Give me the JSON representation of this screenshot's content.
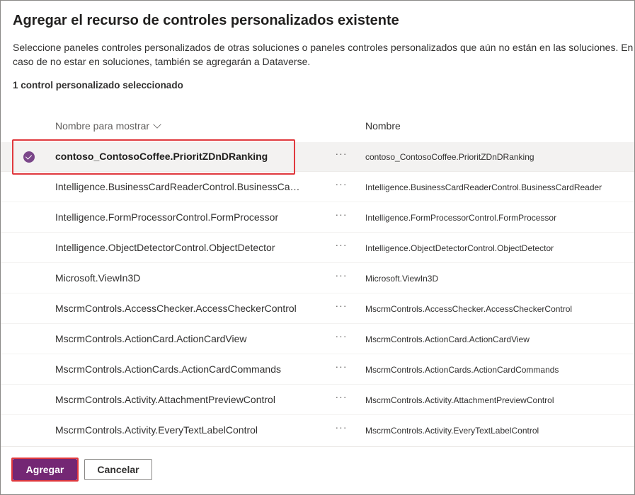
{
  "dialog": {
    "title": "Agregar el recurso de controles personalizados existente",
    "description": "Seleccione paneles controles personalizados de otras soluciones o paneles controles personalizados que aún no están en las soluciones. En caso de no estar en soluciones, también se agregarán a Dataverse.",
    "selected_count": "1 control personalizado seleccionado"
  },
  "table": {
    "columns": {
      "display_name": "Nombre para mostrar",
      "name": "Nombre"
    },
    "more_glyph": "···",
    "rows": [
      {
        "display": "contoso_ContosoCoffee.PrioritZDnDRanking",
        "name": "contoso_ContosoCoffee.PrioritZDnDRanking",
        "selected": true
      },
      {
        "display": "Intelligence.BusinessCardReaderControl.BusinessCardReader",
        "name": "Intelligence.BusinessCardReaderControl.BusinessCardReader",
        "selected": false
      },
      {
        "display": "Intelligence.FormProcessorControl.FormProcessor",
        "name": "Intelligence.FormProcessorControl.FormProcessor",
        "selected": false
      },
      {
        "display": "Intelligence.ObjectDetectorControl.ObjectDetector",
        "name": "Intelligence.ObjectDetectorControl.ObjectDetector",
        "selected": false
      },
      {
        "display": "Microsoft.ViewIn3D",
        "name": "Microsoft.ViewIn3D",
        "selected": false
      },
      {
        "display": "MscrmControls.AccessChecker.AccessCheckerControl",
        "name": "MscrmControls.AccessChecker.AccessCheckerControl",
        "selected": false
      },
      {
        "display": "MscrmControls.ActionCard.ActionCardView",
        "name": "MscrmControls.ActionCard.ActionCardView",
        "selected": false
      },
      {
        "display": "MscrmControls.ActionCards.ActionCardCommands",
        "name": "MscrmControls.ActionCards.ActionCardCommands",
        "selected": false
      },
      {
        "display": "MscrmControls.Activity.AttachmentPreviewControl",
        "name": "MscrmControls.Activity.AttachmentPreviewControl",
        "selected": false
      },
      {
        "display": "MscrmControls.Activity.EveryTextLabelControl",
        "name": "MscrmControls.Activity.EveryTextLabelControl",
        "selected": false
      }
    ]
  },
  "footer": {
    "add_label": "Agregar",
    "cancel_label": "Cancelar"
  },
  "colors": {
    "primary": "#742774",
    "check": "#7a4689",
    "highlight": "#e0393e",
    "selected_row": "#f3f2f1"
  }
}
